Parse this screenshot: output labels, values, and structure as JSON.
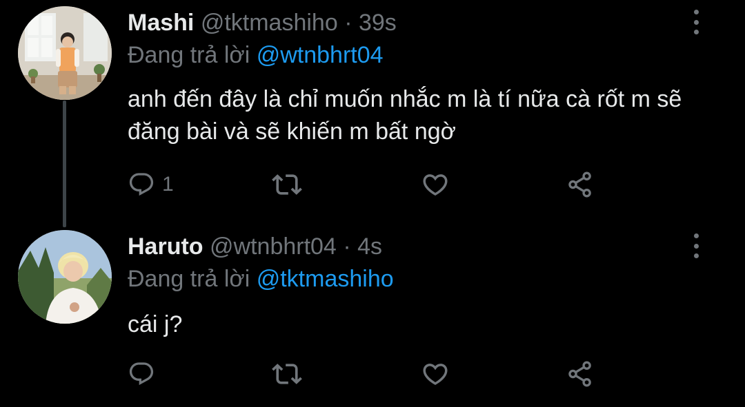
{
  "tweets": [
    {
      "display_name": "Mashi",
      "handle": "@tktmashiho",
      "separator": "·",
      "time": "39s",
      "reply_prefix": "Đang trả lời",
      "reply_to": "@wtnbhrt04",
      "text": "anh đến đây là chỉ muốn nhắc m là tí nữa cà rốt m sẽ đăng bài và sẽ khiến m bất ngờ",
      "reply_count": "1",
      "avatar_icon": "avatar-photo"
    },
    {
      "display_name": "Haruto",
      "handle": "@wtnbhrt04",
      "separator": "·",
      "time": "4s",
      "reply_prefix": "Đang trả lời",
      "reply_to": "@tktmashiho",
      "text": "cái j?",
      "reply_count": "",
      "avatar_icon": "avatar-photo"
    }
  ],
  "icons": {
    "reply": "reply-icon",
    "retweet": "retweet-icon",
    "like": "heart-icon",
    "share": "share-icon",
    "more": "more-options-icon"
  },
  "colors": {
    "background": "#000000",
    "text": "#e7e9ea",
    "secondary": "#71767b",
    "link": "#1d9bf0",
    "thread_line": "#3d4448"
  }
}
